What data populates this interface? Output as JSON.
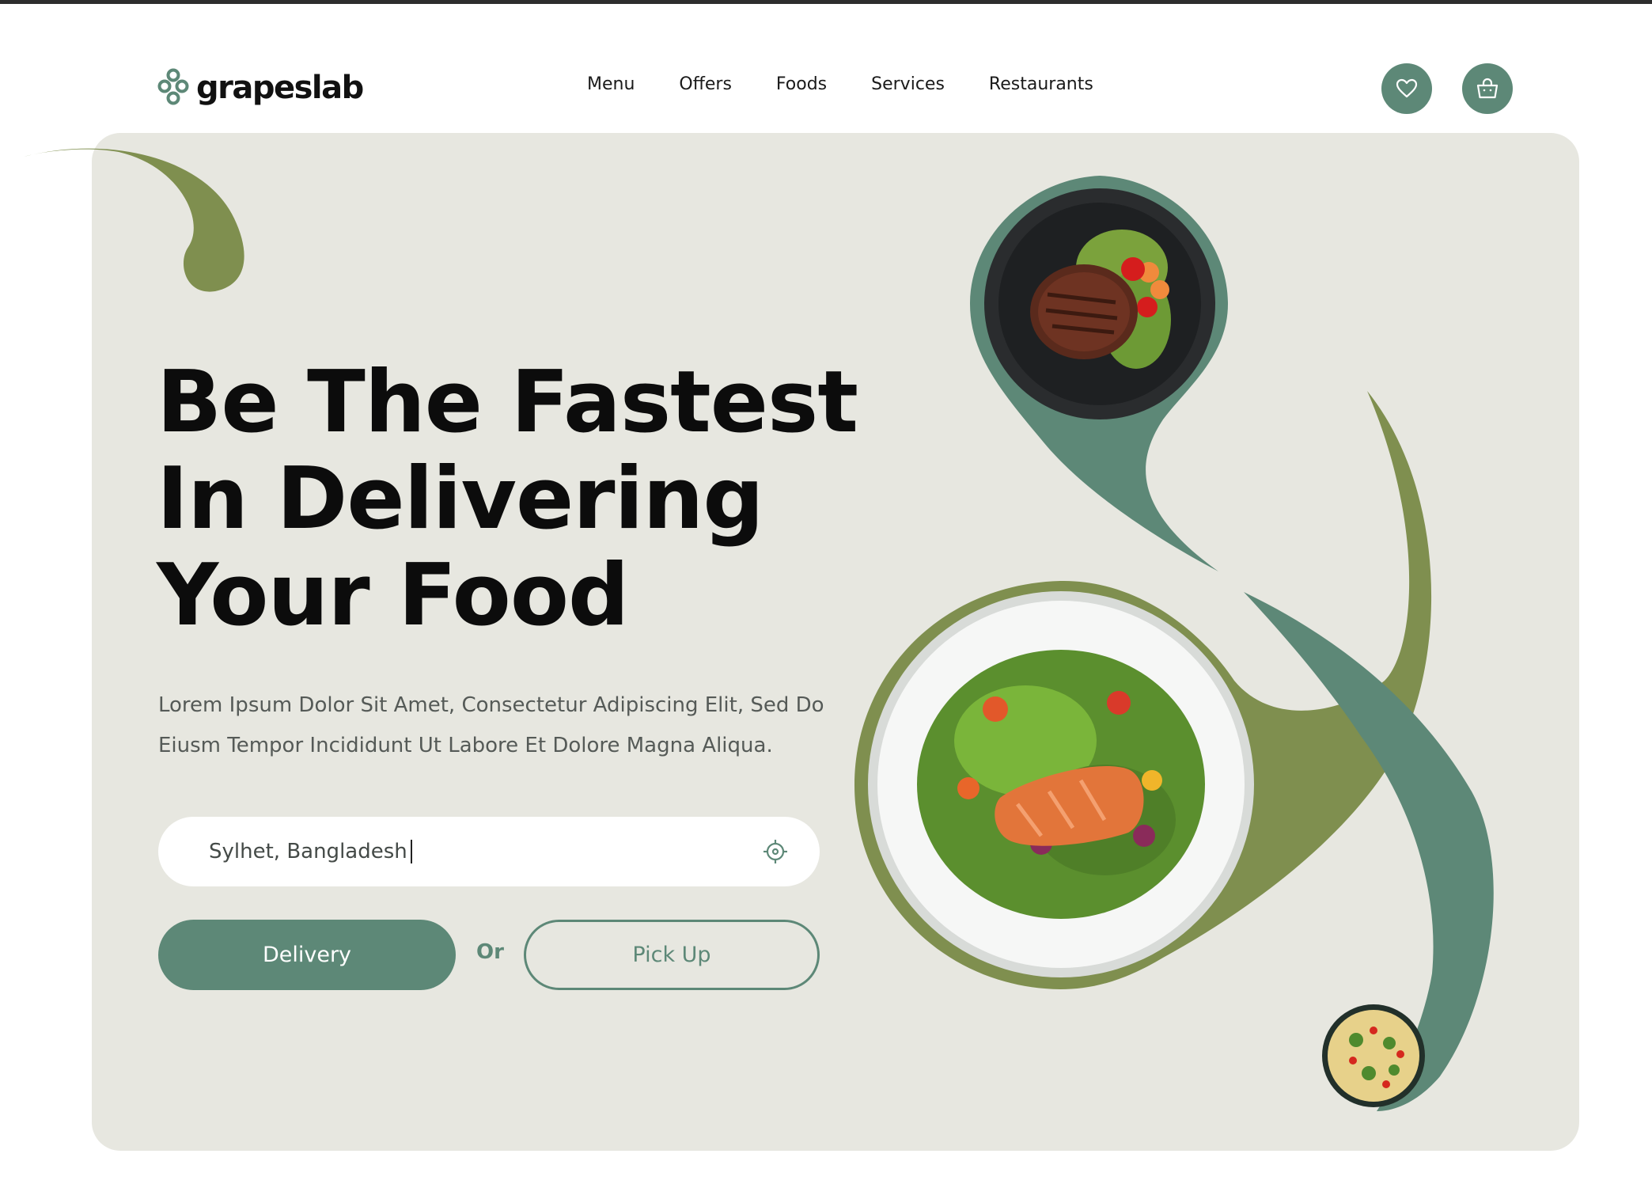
{
  "brand": {
    "name": "grapeslab",
    "logo_icon": "grape-cluster-icon"
  },
  "nav": {
    "items": [
      "Menu",
      "Offers",
      "Foods",
      "Services",
      "Restaurants"
    ]
  },
  "header_actions": {
    "favorites_icon": "heart-icon",
    "cart_icon": "shopping-basket-icon"
  },
  "hero": {
    "title_lines": [
      "Be The Fastest",
      "In Delivering",
      "Your Food"
    ],
    "description": "Lorem Ipsum Dolor Sit Amet, Consectetur Adipiscing Elit, Sed Do Eiusm Tempor Incididunt Ut Labore Et Dolore Magna Aliqua.",
    "location_value": "Sylhet, Bangladesh",
    "locate_icon": "crosshair-location-icon",
    "delivery_label": "Delivery",
    "or_label": "Or",
    "pickup_label": "Pick Up"
  },
  "images": {
    "dish_top": "steak-salad-plate",
    "dish_center": "salmon-salad-plate",
    "dish_small": "pasta-salad-bowl"
  },
  "colors": {
    "primary_green": "#5d8877",
    "olive_green": "#7f8f4f",
    "hero_background": "#e7e7e0",
    "text_dark": "#0c0c0c"
  }
}
